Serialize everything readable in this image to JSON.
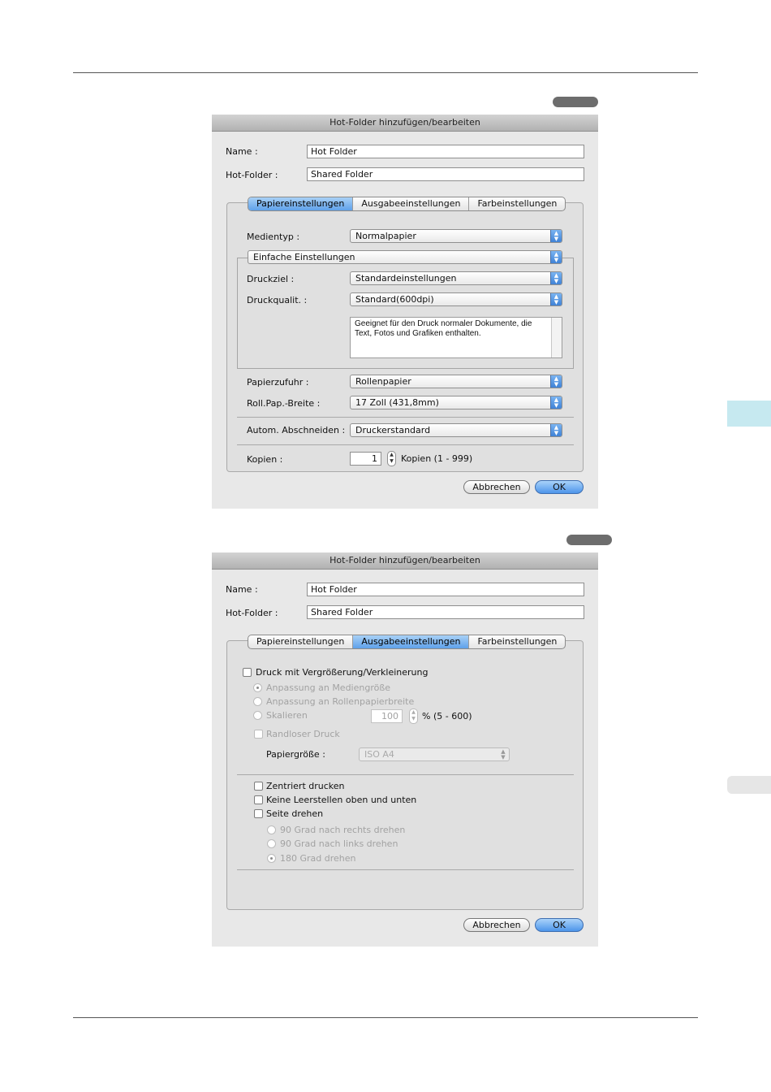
{
  "dialog1": {
    "title": "Hot-Folder hinzufügen/bearbeiten",
    "name_label": "Name :",
    "name_value": "Hot Folder",
    "hotfolder_label": "Hot-Folder :",
    "hotfolder_value": "Shared Folder",
    "tabs": [
      {
        "label": "Papiereinstellungen",
        "active": true
      },
      {
        "label": "Ausgabeeinstellungen",
        "active": false
      },
      {
        "label": "Farbeinstellungen",
        "active": false
      }
    ],
    "medientyp_label": "Medientyp :",
    "medientyp_value": "Normalpapier",
    "mode_value": "Einfache Einstellungen",
    "druckziel_label": "Druckziel :",
    "druckziel_value": "Standardeinstellungen",
    "druckqualitaet_label": "Druckqualit. :",
    "druckqualitaet_value": "Standard(600dpi)",
    "description": "Geeignet für den Druck normaler Dokumente, die Text, Fotos und Grafiken enthalten.",
    "papierzufuhr_label": "Papierzufuhr :",
    "papierzufuhr_value": "Rollenpapier",
    "rollbreite_label": "Roll.Pap.-Breite :",
    "rollbreite_value": "17 Zoll (431,8mm)",
    "abschneiden_label": "Autom. Abschneiden :",
    "abschneiden_value": "Druckerstandard",
    "kopien_label": "Kopien :",
    "kopien_value": "1",
    "kopien_range": "Kopien (1 - 999)",
    "cancel": "Abbrechen",
    "ok": "OK"
  },
  "dialog2": {
    "title": "Hot-Folder hinzufügen/bearbeiten",
    "name_label": "Name :",
    "name_value": "Hot Folder",
    "hotfolder_label": "Hot-Folder :",
    "hotfolder_value": "Shared Folder",
    "tabs": [
      {
        "label": "Papiereinstellungen",
        "active": false
      },
      {
        "label": "Ausgabeeinstellungen",
        "active": true
      },
      {
        "label": "Farbeinstellungen",
        "active": false
      }
    ],
    "enlarge_label": "Druck mit Vergrößerung/Verkleinerung",
    "fit_media": "Anpassung an Mediengröße",
    "fit_roll": "Anpassung an Rollenpapierbreite",
    "scale": "Skalieren",
    "scale_value": "100",
    "scale_range": "% (5 - 600)",
    "borderless": "Randloser Druck",
    "paper_size_label": "Papiergröße :",
    "paper_size_value": "ISO A4",
    "centered": "Zentriert drucken",
    "no_spaces": "Keine Leerstellen oben und unten",
    "rotate": "Seite drehen",
    "rot_right": "90 Grad nach rechts drehen",
    "rot_left": "90 Grad nach links drehen",
    "rot_180": "180 Grad drehen",
    "cancel": "Abbrechen",
    "ok": "OK"
  }
}
